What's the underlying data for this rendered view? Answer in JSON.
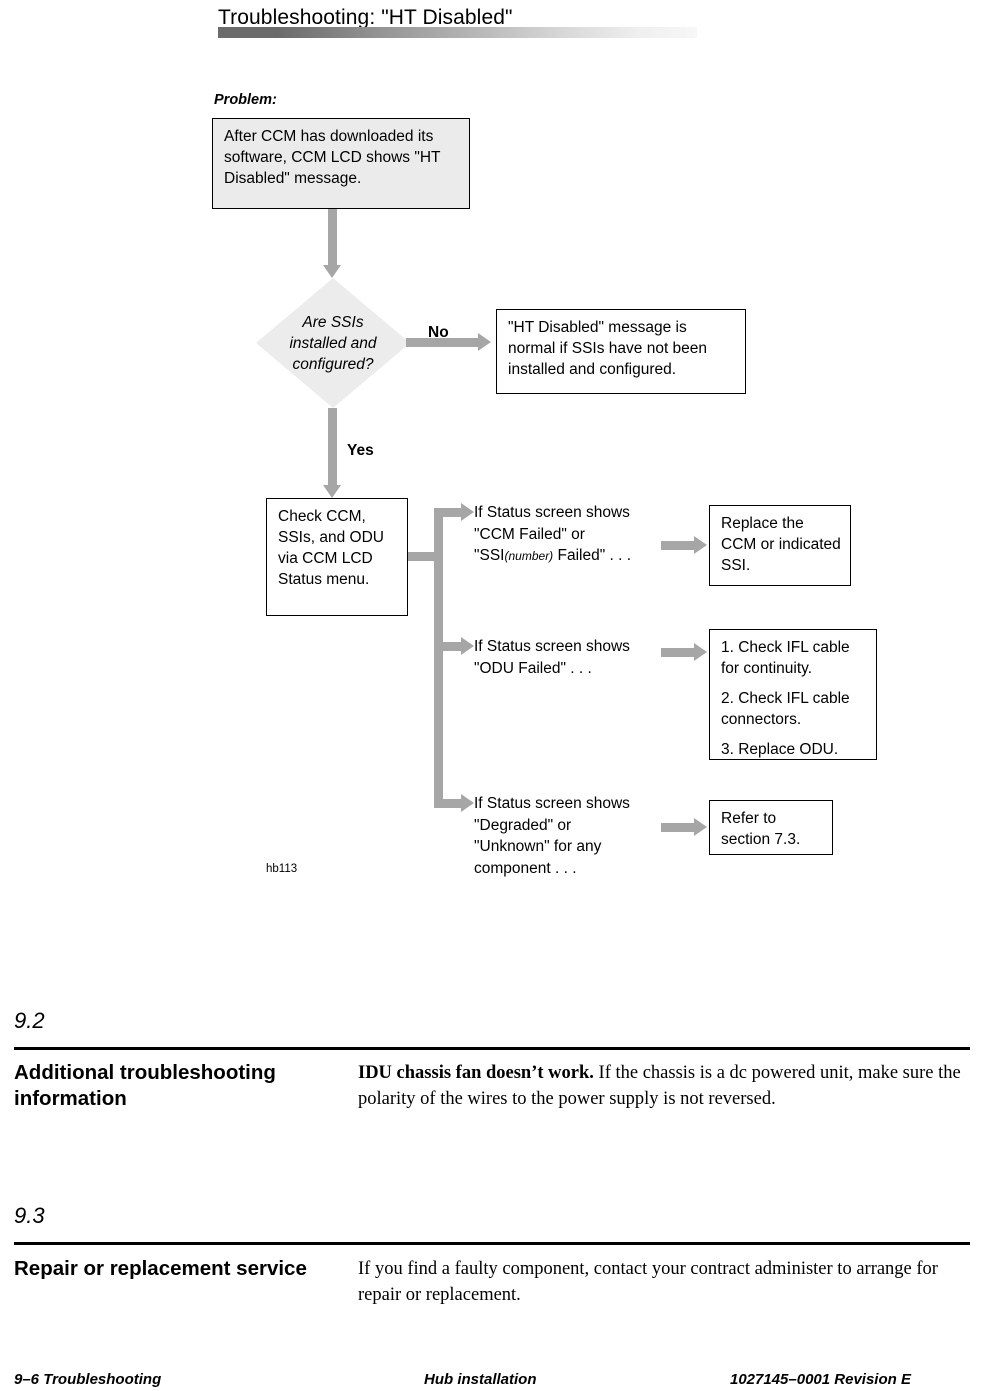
{
  "header": {
    "title": "Troubleshooting: \"HT Disabled\""
  },
  "flowchart": {
    "figure_id": "hb113",
    "problem_label": "Problem:",
    "problem_box": "After CCM has downloaded its software, CCM LCD shows \"HT Disabled\" message.",
    "decision": {
      "line1": "Are SSIs",
      "line2": "installed and",
      "line3": "configured?",
      "branch_no": "No",
      "branch_yes": "Yes"
    },
    "no_result_box": "\"HT Disabled\" message is normal if SSIs have not been installed and configured.",
    "action_box": "Check CCM, SSIs, and ODU via CCM LCD Status menu.",
    "branches": [
      {
        "condition_line1": "If Status screen shows",
        "condition_line2": "\"CCM Failed\" or",
        "condition_line3_pre": "\"SSI",
        "condition_line3_ital": "(number)",
        "condition_line3_post": " Failed\" . . .",
        "result": "Replace the CCM or indicated SSI."
      },
      {
        "condition_line1": "If Status screen shows",
        "condition_line2": "\"ODU Failed\" . . .",
        "result_items": [
          "1. Check IFL cable for continuity.",
          "2. Check IFL cable connectors.",
          "3. Replace ODU."
        ]
      },
      {
        "condition_line1": "If Status screen shows",
        "condition_line2": "\"Degraded\" or",
        "condition_line3": "\"Unknown\" for any",
        "condition_line4": "component . . .",
        "result": "Refer to section 7.3."
      }
    ]
  },
  "sections": [
    {
      "number": "9.2",
      "heading": "Additional troubleshooting information",
      "body_bold": "IDU chassis fan doesn’t work.",
      "body_rest": " If the chassis is a dc powered unit, make sure the polarity of the wires to the power supply is not reversed."
    },
    {
      "number": "9.3",
      "heading": "Repair or replacement service",
      "body_bold": "",
      "body_rest": "If you find a faulty component, contact your contract administer to arrange for repair or replacement."
    }
  ],
  "footer": {
    "left": "9–6  Troubleshooting",
    "center": "Hub installation",
    "right": "1027145–0001   Revision E"
  },
  "colors": {
    "arrow_gray": "#a6a6a6",
    "shade_gray": "#ebebeb",
    "diamond_gray": "#ececec"
  }
}
